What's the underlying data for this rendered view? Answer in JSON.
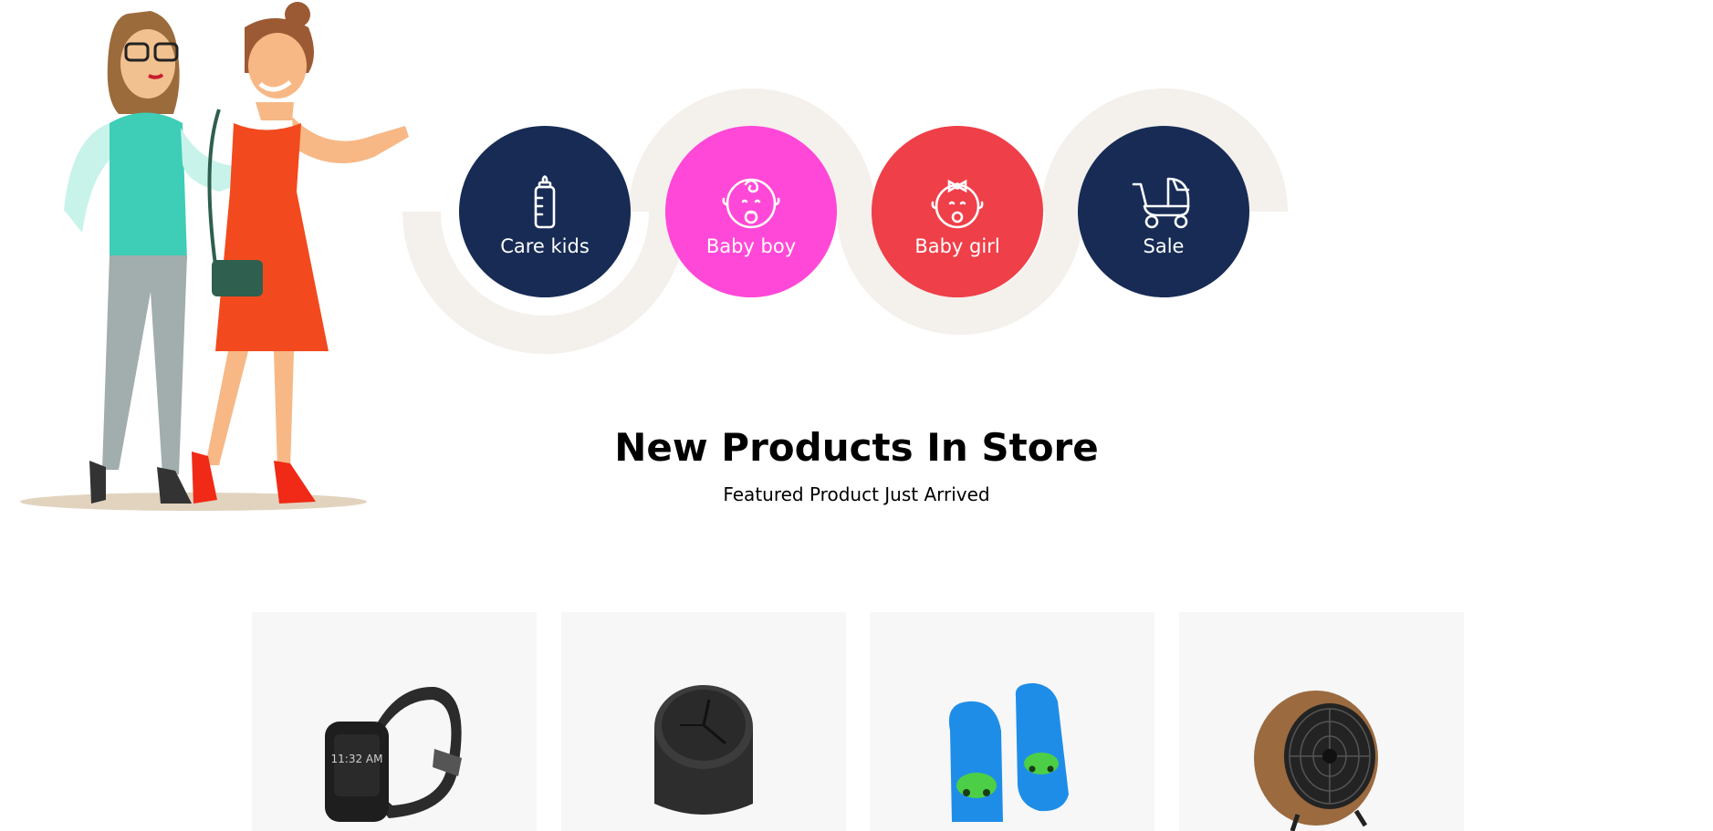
{
  "categories": [
    {
      "label": "Care kids",
      "icon": "baby-bottle-icon",
      "color": "#172b55"
    },
    {
      "label": "Baby boy",
      "icon": "baby-boy-face-icon",
      "color": "#ff48d8"
    },
    {
      "label": "Baby girl",
      "icon": "baby-girl-face-icon",
      "color": "#ef3f49"
    },
    {
      "label": "Sale",
      "icon": "baby-stroller-icon",
      "color": "#172b55"
    }
  ],
  "section": {
    "title": "New Products In Store",
    "subtitle": "Featured Product Just Arrived"
  },
  "products": [
    {
      "image": "smartwatch-image",
      "watch_time": "11:32 AM"
    },
    {
      "image": "desk-clock-image"
    },
    {
      "image": "blue-slippers-image"
    },
    {
      "image": "wooden-fan-image"
    }
  ],
  "colors": {
    "navy": "#172b55",
    "pink": "#ff48d8",
    "red": "#ef3f49",
    "arc": "#f4f0ec",
    "card": "#f7f7f7"
  }
}
